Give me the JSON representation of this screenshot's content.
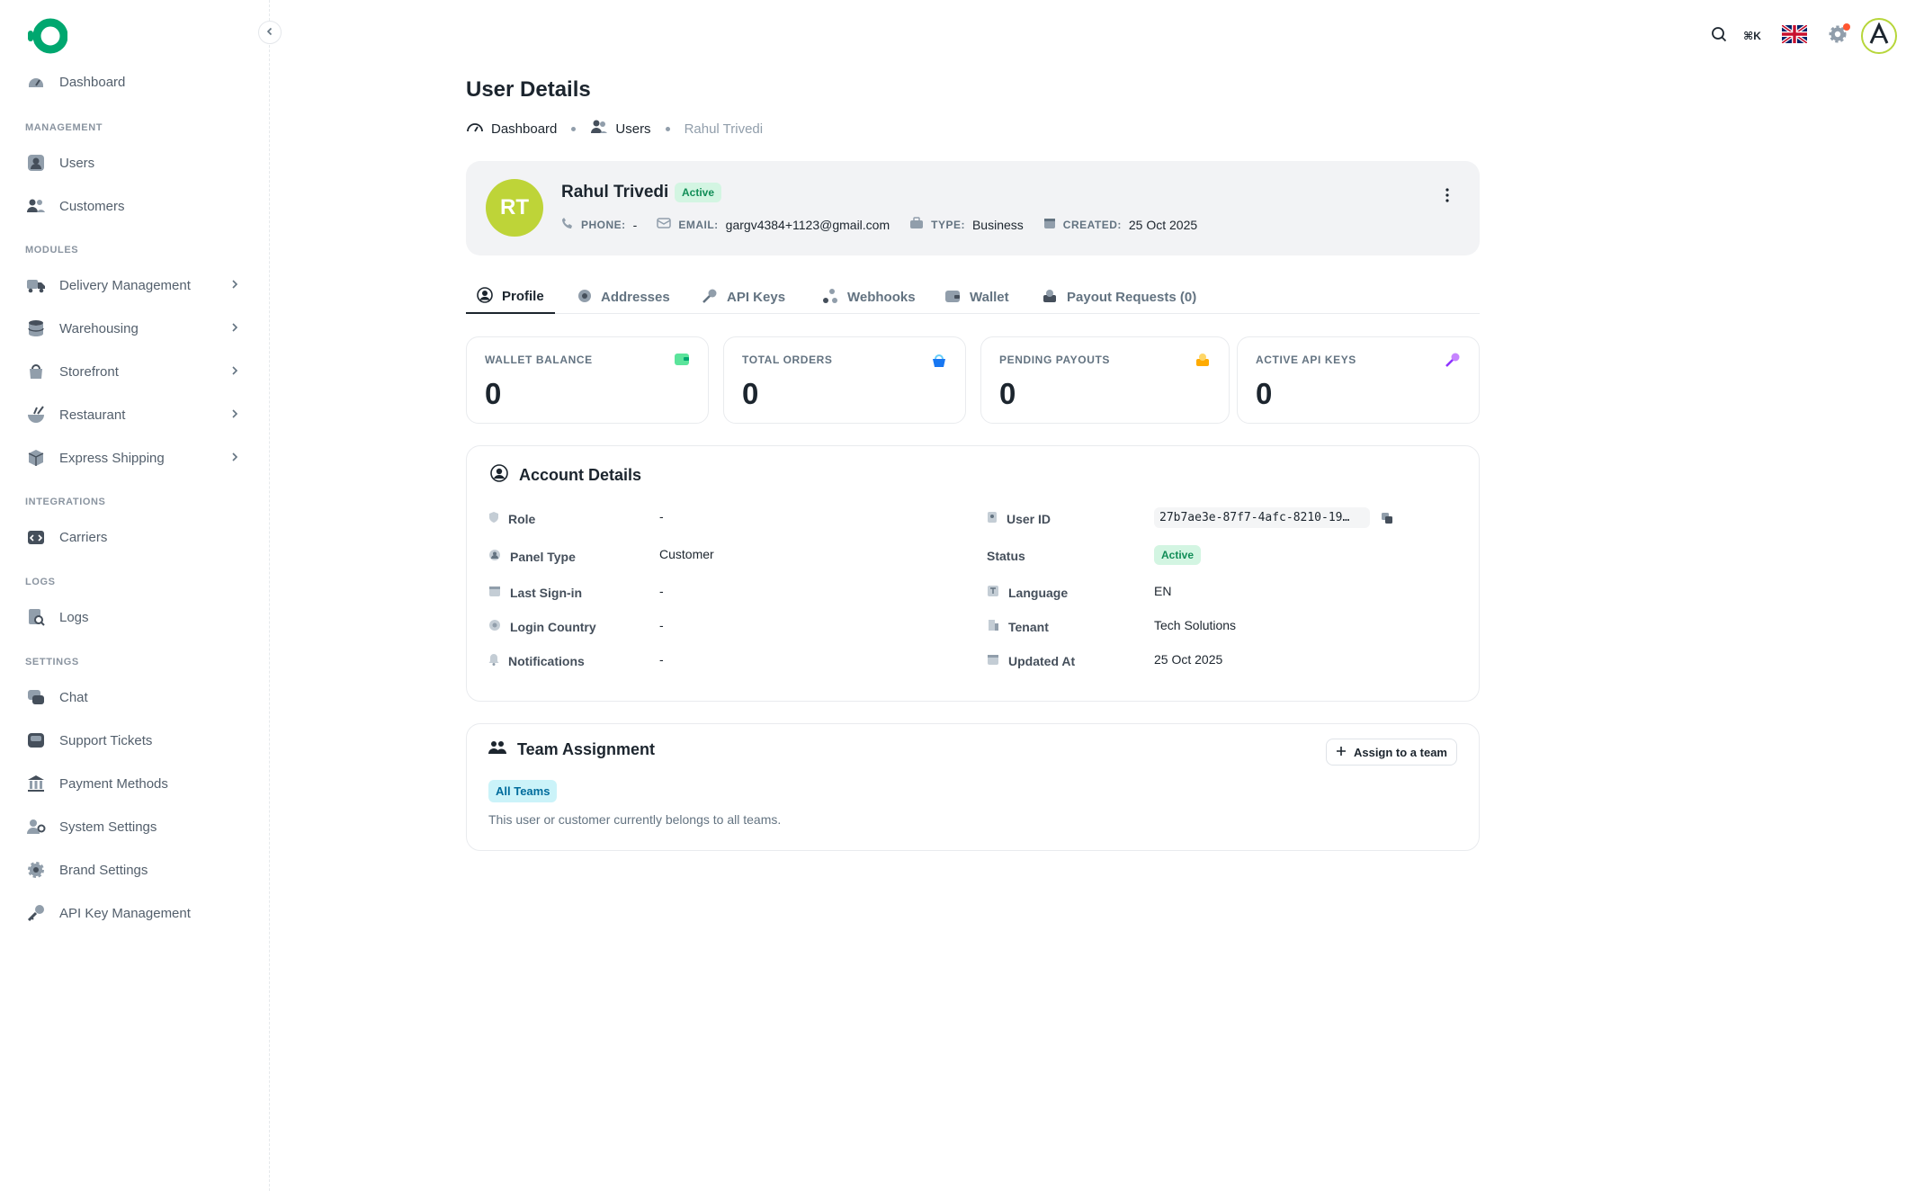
{
  "sidebar": {
    "items": [
      {
        "key": "dashboard",
        "label": "Dashboard",
        "icon": "dashboard-icon"
      },
      {
        "key": "users",
        "label": "Users",
        "icon": "user-icon"
      },
      {
        "key": "customers",
        "label": "Customers",
        "icon": "customers-icon"
      },
      {
        "key": "delivery",
        "label": "Delivery Management",
        "icon": "truck-icon"
      },
      {
        "key": "warehousing",
        "label": "Warehousing",
        "icon": "warehouse-icon"
      },
      {
        "key": "storefront",
        "label": "Storefront",
        "icon": "bag-icon"
      },
      {
        "key": "restaurant",
        "label": "Restaurant",
        "icon": "restaurant-icon"
      },
      {
        "key": "express",
        "label": "Express Shipping",
        "icon": "box-icon"
      },
      {
        "key": "carriers",
        "label": "Carriers",
        "icon": "carrier-icon"
      },
      {
        "key": "logs",
        "label": "Logs",
        "icon": "logs-icon"
      },
      {
        "key": "chat",
        "label": "Chat",
        "icon": "chat-icon"
      },
      {
        "key": "support",
        "label": "Support Tickets",
        "icon": "ticket-icon"
      },
      {
        "key": "payment",
        "label": "Payment Methods",
        "icon": "bank-icon"
      },
      {
        "key": "system",
        "label": "System Settings",
        "icon": "user-gear-icon"
      },
      {
        "key": "brand",
        "label": "Brand Settings",
        "icon": "gear-icon"
      },
      {
        "key": "apikeys",
        "label": "API Key Management",
        "icon": "key-icon"
      }
    ],
    "sections": {
      "management": "MANAGEMENT",
      "modules": "MODULES",
      "integrations": "INTEGRATIONS",
      "logs": "LOGS",
      "settings": "SETTINGS"
    }
  },
  "topbar": {
    "shortcut": "⌘K",
    "language_flag": "uk-flag-icon"
  },
  "page": {
    "title": "User Details",
    "breadcrumb": {
      "dashboard": "Dashboard",
      "users": "Users",
      "current": "Rahul Trivedi"
    }
  },
  "user": {
    "initials": "RT",
    "name": "Rahul Trivedi",
    "status": "Active",
    "phone_label": "PHONE:",
    "phone": "-",
    "email_label": "EMAIL:",
    "email": "gargv4384+1123@gmail.com",
    "type_label": "TYPE:",
    "type": "Business",
    "created_label": "CREATED:",
    "created": "25 Oct 2025"
  },
  "tabs": {
    "profile": "Profile",
    "addresses": "Addresses",
    "api_keys": "API Keys",
    "webhooks": "Webhooks",
    "wallet": "Wallet",
    "payout": "Payout Requests (0)"
  },
  "stats": {
    "wallet_label": "WALLET BALANCE",
    "wallet_value": "0",
    "orders_label": "TOTAL ORDERS",
    "orders_value": "0",
    "payouts_label": "PENDING PAYOUTS",
    "payouts_value": "0",
    "apikeys_label": "ACTIVE API KEYS",
    "apikeys_value": "0"
  },
  "account": {
    "title": "Account Details",
    "role_label": "Role",
    "role": "-",
    "panel_label": "Panel Type",
    "panel": "Customer",
    "signin_label": "Last Sign-in",
    "signin": "-",
    "country_label": "Login Country",
    "country": "-",
    "notif_label": "Notifications",
    "notif": "-",
    "userid_label": "User ID",
    "userid": "27b7ae3e-87f7-4afc-8210-19…",
    "status_label": "Status",
    "status": "Active",
    "lang_label": "Language",
    "lang": "EN",
    "tenant_label": "Tenant",
    "tenant": "Tech Solutions",
    "updated_label": "Updated At",
    "updated": "25 Oct 2025"
  },
  "team": {
    "title": "Team Assignment",
    "assign_label": "Assign to a team",
    "chip": "All Teams",
    "description": "This user or customer currently belongs to all teams."
  },
  "colors": {
    "brand": "#00a76f",
    "avatar": "#bed438",
    "active_bg": "#d3f5e2",
    "active_text": "#118d57",
    "notification": "#ff5630"
  }
}
